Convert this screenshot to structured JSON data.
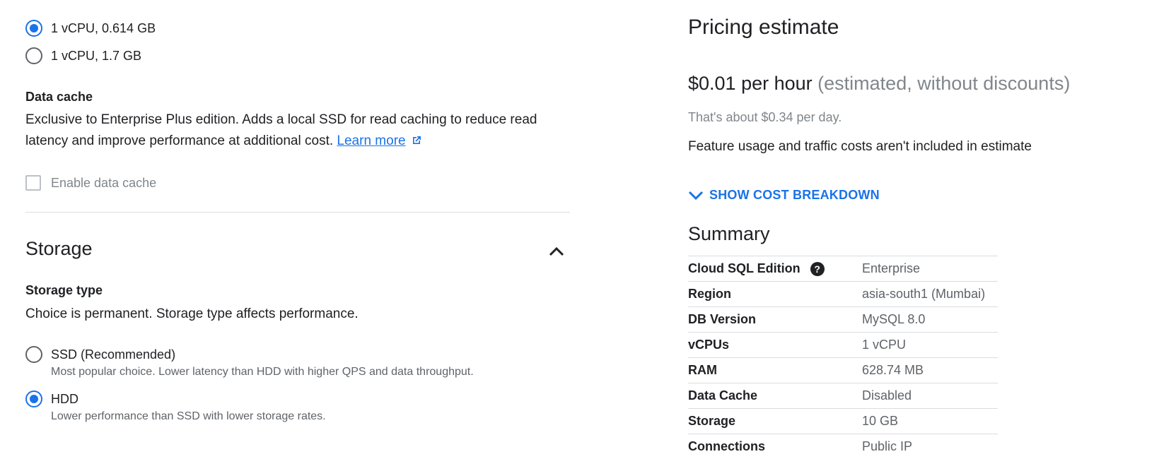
{
  "machine": {
    "options": [
      {
        "label": "1 vCPU, 0.614 GB",
        "checked": true
      },
      {
        "label": "1 vCPU, 1.7 GB",
        "checked": false
      }
    ]
  },
  "data_cache": {
    "title": "Data cache",
    "description": "Exclusive to Enterprise Plus edition. Adds a local SSD for read caching to reduce read latency and improve performance at additional cost.",
    "learn_more": "Learn more",
    "checkbox_label": "Enable data cache"
  },
  "storage": {
    "title": "Storage",
    "type_title": "Storage type",
    "type_description": "Choice is permanent. Storage type affects performance.",
    "options": [
      {
        "label": "SSD (Recommended)",
        "help": "Most popular choice. Lower latency than HDD with higher QPS and data throughput.",
        "checked": false
      },
      {
        "label": "HDD",
        "help": "Lower performance than SSD with lower storage rates.",
        "checked": true
      }
    ]
  },
  "pricing": {
    "title": "Pricing estimate",
    "price": "$0.01 per hour",
    "price_note": "(estimated, without discounts)",
    "per_day": "That's about $0.34 per day.",
    "feature_note": "Feature usage and traffic costs aren't included in estimate",
    "breakdown_label": "SHOW COST BREAKDOWN"
  },
  "summary": {
    "title": "Summary",
    "rows": [
      {
        "key": "Cloud SQL Edition",
        "value": "Enterprise"
      },
      {
        "key": "Region",
        "value": "asia-south1 (Mumbai)"
      },
      {
        "key": "DB Version",
        "value": "MySQL 8.0"
      },
      {
        "key": "vCPUs",
        "value": "1 vCPU"
      },
      {
        "key": "RAM",
        "value": "628.74 MB"
      },
      {
        "key": "Data Cache",
        "value": "Disabled"
      },
      {
        "key": "Storage",
        "value": "10 GB"
      },
      {
        "key": "Connections",
        "value": "Public IP"
      }
    ]
  },
  "colors": {
    "accent": "#1a73e8",
    "text": "#202124",
    "muted": "#5f6368"
  }
}
